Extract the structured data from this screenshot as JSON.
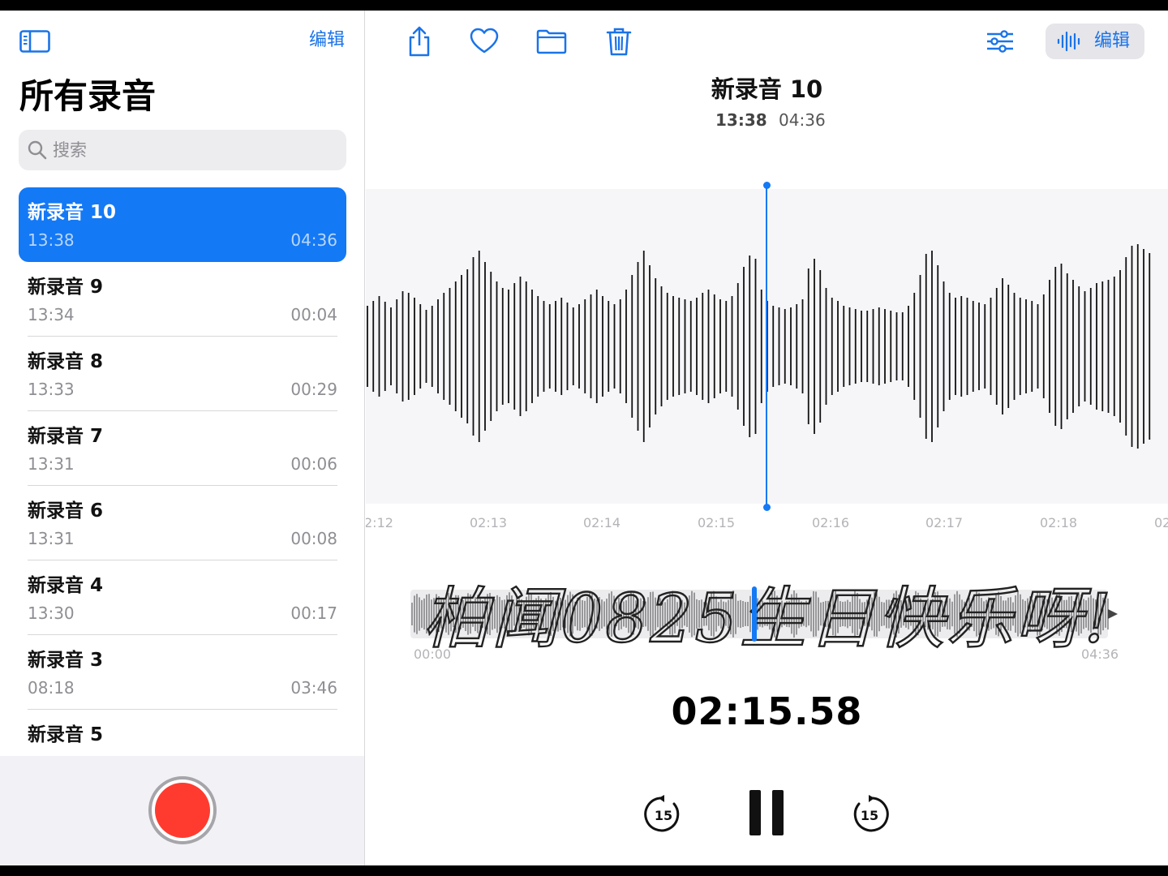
{
  "sidebar": {
    "edit_label": "编辑",
    "title": "所有录音",
    "search_placeholder": "搜索",
    "recordings": [
      {
        "title": "新录音 10",
        "time": "13:38",
        "duration": "04:36",
        "selected": true
      },
      {
        "title": "新录音 9",
        "time": "13:34",
        "duration": "00:04"
      },
      {
        "title": "新录音 8",
        "time": "13:33",
        "duration": "00:29"
      },
      {
        "title": "新录音 7",
        "time": "13:31",
        "duration": "00:06"
      },
      {
        "title": "新录音 6",
        "time": "13:31",
        "duration": "00:08"
      },
      {
        "title": "新录音 4",
        "time": "13:30",
        "duration": "00:17"
      },
      {
        "title": "新录音 3",
        "time": "08:18",
        "duration": "03:46"
      },
      {
        "title": "新录音 5",
        "time": "",
        "duration": ""
      }
    ]
  },
  "toolbar": {
    "icons": [
      "share-icon",
      "heart-icon",
      "folder-icon",
      "trash-icon",
      "options-icon"
    ],
    "edit_label": "编辑"
  },
  "detail": {
    "title": "新录音 10",
    "time": "13:38",
    "duration": "04:36",
    "timeline_ticks": [
      "2:12",
      "02:13",
      "02:14",
      "02:15",
      "02:16",
      "02:17",
      "02:18",
      "02"
    ],
    "overview_start": "00:00",
    "overview_end": "04:36",
    "current_time": "02:15.58",
    "handwriting": "柏闻0825生日快乐呀!",
    "skip_seconds": "15",
    "progress_fraction": 0.49
  },
  "colors": {
    "accent": "#1479f5",
    "record": "#ff3b30",
    "waveform": "#111111",
    "wave_background": "#f6f6f8"
  }
}
